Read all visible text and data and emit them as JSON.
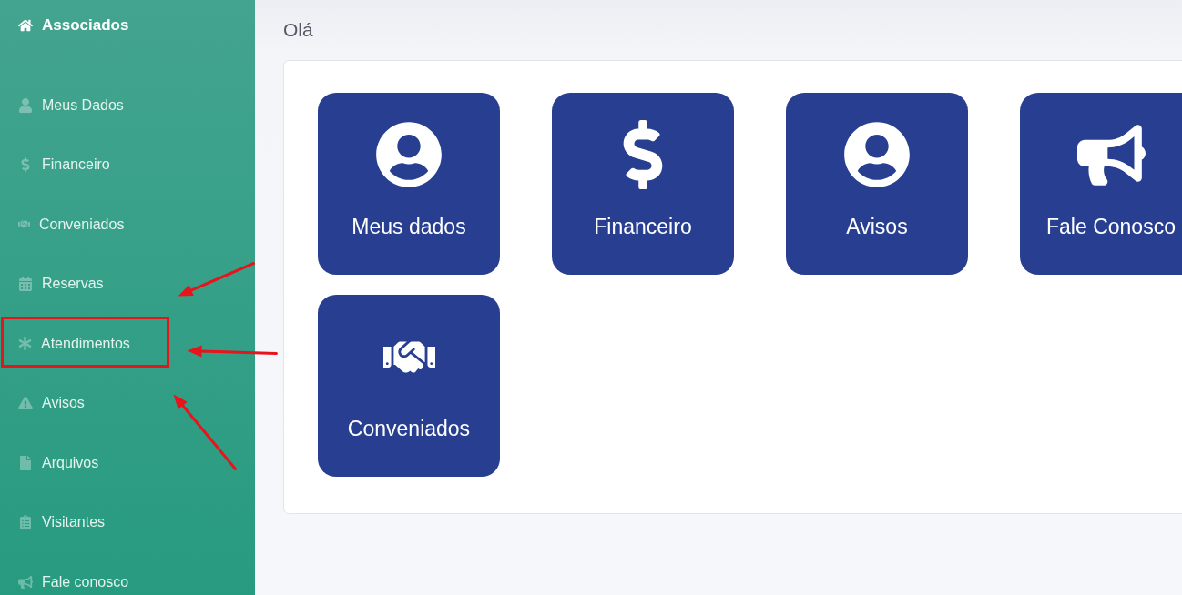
{
  "sidebar": {
    "title": "Associados",
    "items": [
      {
        "label": "Meus Dados",
        "highlighted": false
      },
      {
        "label": "Financeiro",
        "highlighted": false
      },
      {
        "label": "Conveniados",
        "highlighted": false
      },
      {
        "label": "Reservas",
        "highlighted": false
      },
      {
        "label": "Atendimentos",
        "highlighted": true
      },
      {
        "label": "Avisos",
        "highlighted": false
      },
      {
        "label": "Arquivos",
        "highlighted": false
      },
      {
        "label": "Visitantes",
        "highlighted": false
      },
      {
        "label": "Fale conosco",
        "highlighted": false
      }
    ]
  },
  "greeting": "Olá",
  "tiles": [
    {
      "label": "Meus dados"
    },
    {
      "label": "Financeiro"
    },
    {
      "label": "Avisos"
    },
    {
      "label": "Fale Conosco"
    },
    {
      "label": "Conveniados"
    }
  ],
  "annotations": [
    {
      "kind": "arrow"
    },
    {
      "kind": "arrow"
    },
    {
      "kind": "arrow"
    }
  ]
}
